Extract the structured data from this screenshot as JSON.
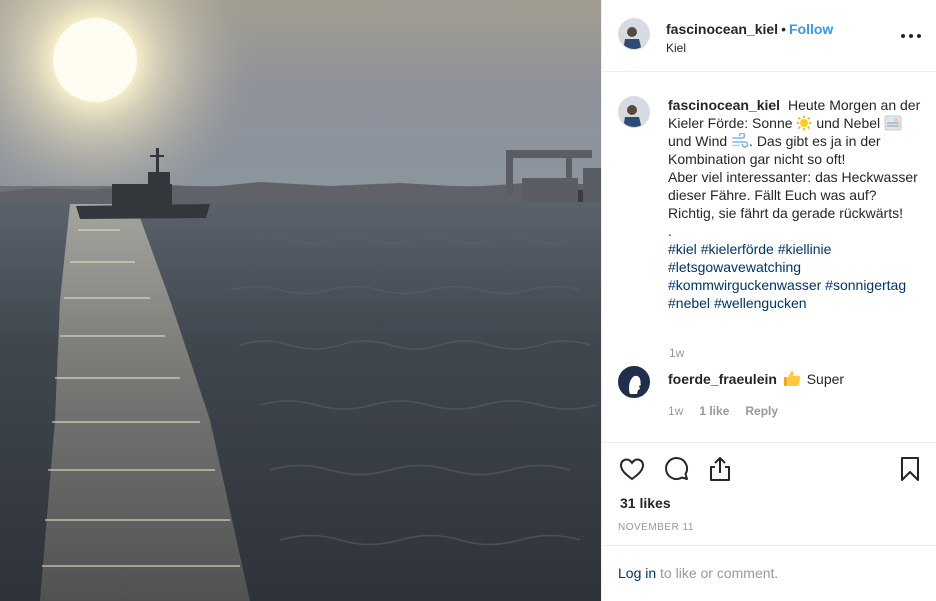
{
  "photo": {
    "description_icon": "photo-harbor-sunrise"
  },
  "header": {
    "username": "fascinocean_kiel",
    "separator": "•",
    "follow_label": "Follow",
    "location": "Kiel",
    "more_icon": "more-options-icon"
  },
  "caption": {
    "username": "fascinocean_kiel",
    "line1": "Heute Morgen an der Kieler Förde: Sonne",
    "part_fog": "und Nebel",
    "part_wind": "und Wind",
    "part_after_wind": ". Das gibt es ja in der Kombination gar nicht so oft!",
    "line2": "Aber viel interessanter: das Heckwasser dieser Fähre. Fällt Euch was auf? Richtig, sie fährt da gerade rückwärts!",
    "line3": ".",
    "hashtags": [
      "#kiel",
      "#kielerförde",
      "#kiellinie",
      "#letsgowavewatching",
      "#kommwirguckenwasser",
      "#sonnigertag",
      "#nebel",
      "#wellengucken"
    ],
    "time": "1w"
  },
  "comment": {
    "username": "foerde_fraeulein",
    "text": "Super",
    "time": "1w",
    "likes_label": "1 like",
    "reply_label": "Reply"
  },
  "actions": {
    "likes": "31 likes",
    "date": "NOVEMBER 11"
  },
  "login": {
    "link_label": "Log in",
    "rest": " to like or comment."
  },
  "colors": {
    "link_blue": "#3897f0",
    "hashtag_blue": "#003569",
    "muted": "#999999",
    "text": "#262626",
    "border": "#efefef"
  }
}
